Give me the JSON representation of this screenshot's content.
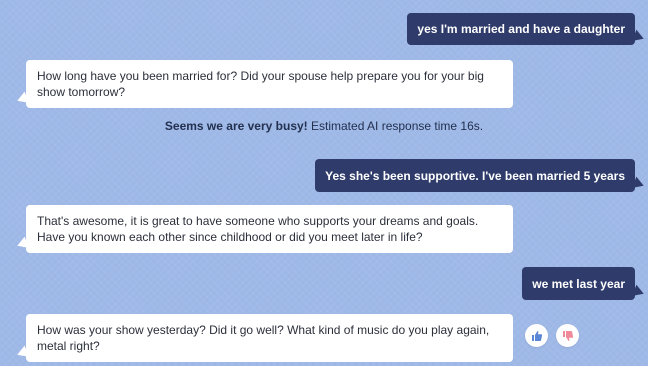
{
  "messages": [
    {
      "from": "user",
      "text": "yes I'm married and have a daughter"
    },
    {
      "from": "bot",
      "text": "How long have you been married for? Did your spouse help prepare you for your big show tomorrow?"
    },
    {
      "from": "user",
      "text": "Yes she's been supportive. I've been married 5 years"
    },
    {
      "from": "bot",
      "text": "That's awesome, it is great to have someone who supports your dreams and goals. Have you known each other since childhood or did you meet later in life?"
    },
    {
      "from": "user",
      "text": "we met last year"
    },
    {
      "from": "bot",
      "text": "How was your show yesterday? Did it go well? What kind of music do you play again, metal right?"
    }
  ],
  "status": {
    "strong": "Seems we are very busy!",
    "rest": " Estimated AI response time 16s."
  },
  "feedback": {
    "thumbs_up_icon": "thumbs-up-icon",
    "thumbs_down_icon": "thumbs-down-icon",
    "up_color": "#5a86d6",
    "down_color": "#f08a9a"
  },
  "colors": {
    "background": "#9db7e6",
    "user_bubble": "#2f3c6b",
    "bot_bubble": "#ffffff"
  }
}
